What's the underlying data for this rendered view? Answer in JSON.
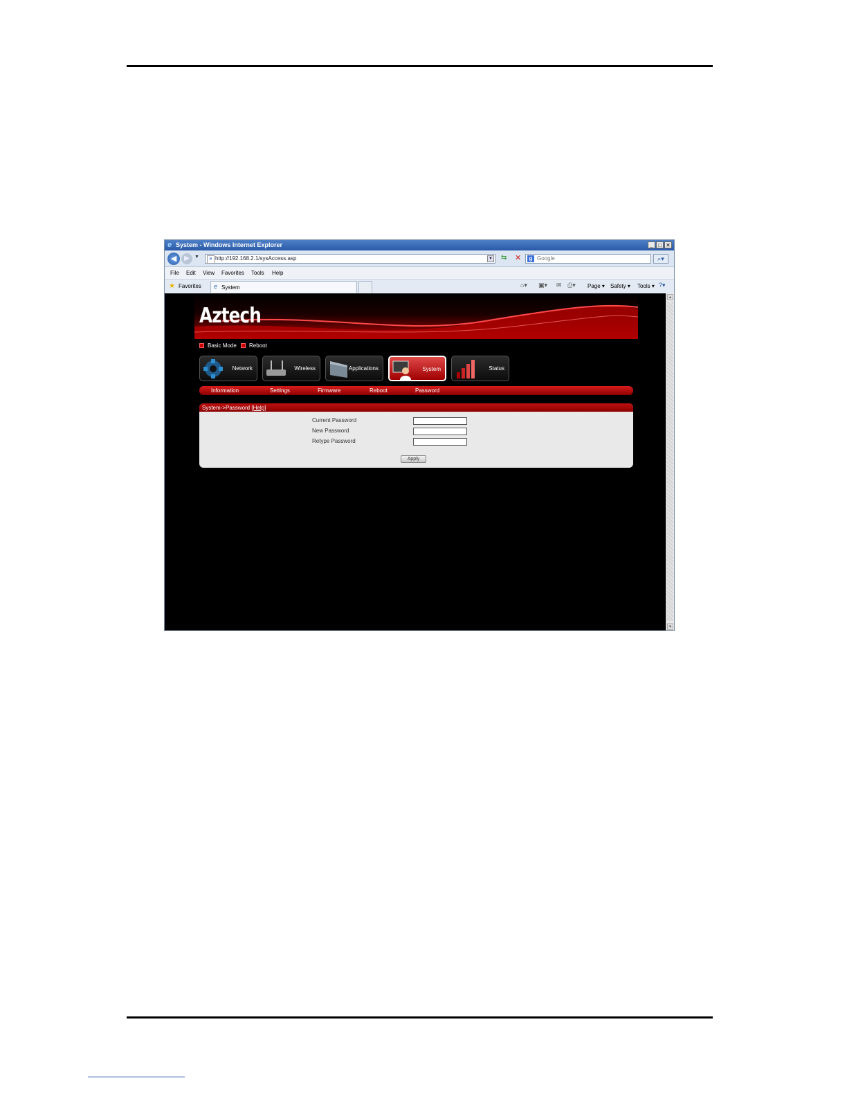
{
  "browser": {
    "window_title": "System - Windows Internet Explorer",
    "address": "http://192.168.2.1/sysAccess.asp",
    "search_placeholder": "Google",
    "menu": [
      "File",
      "Edit",
      "View",
      "Favorites",
      "Tools",
      "Help"
    ],
    "favorites_label": "Favorites",
    "tab_title": "System",
    "command_bar": [
      "Page",
      "Safety",
      "Tools"
    ]
  },
  "router": {
    "brand": "Aztech",
    "quick_links": [
      "Basic Mode",
      "Reboot"
    ],
    "modules": [
      "Network",
      "Wireless",
      "Applications",
      "System",
      "Status"
    ],
    "active_module": "System",
    "subnav": [
      "Information",
      "Settings",
      "Firmware",
      "Reboot",
      "Password"
    ],
    "panel_title": "System->Password",
    "help_link": "[Help]",
    "fields": [
      "Current Password",
      "New Password",
      "Retype Password"
    ],
    "apply_label": "Apply"
  },
  "colors": {
    "accent_red": "#c00000",
    "page_bg": "#000000",
    "panel_bg": "#e9e9e9"
  }
}
